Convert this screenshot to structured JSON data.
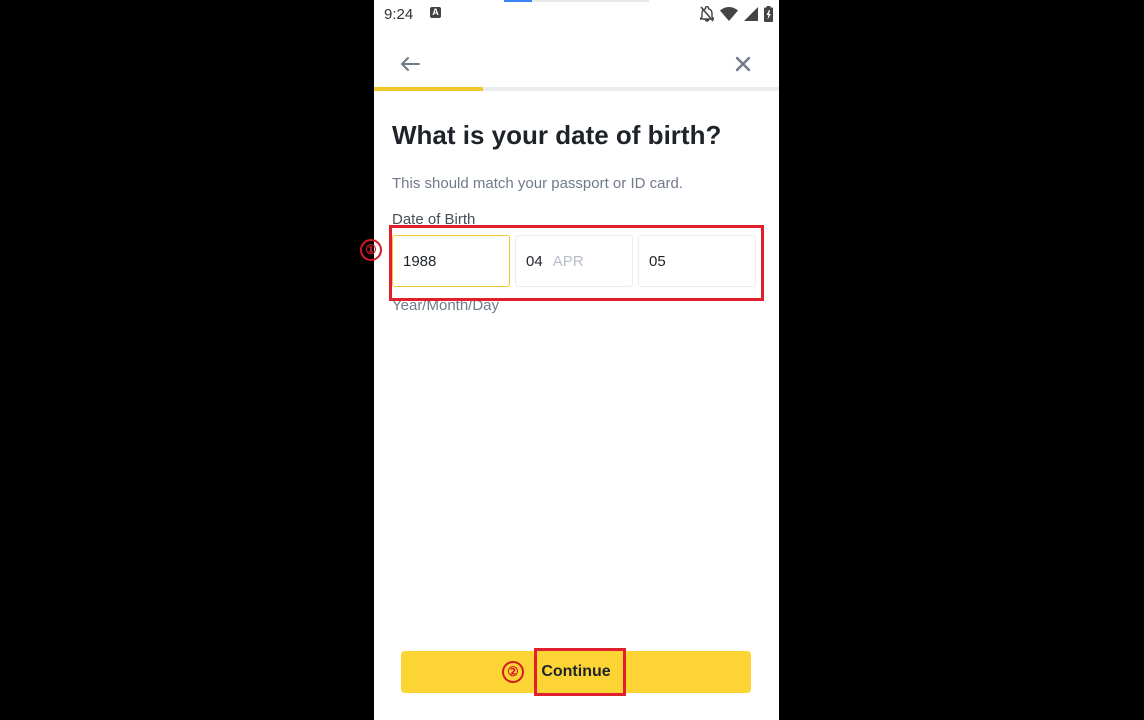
{
  "status_bar": {
    "time": "9:24",
    "app_icon_letter": "A",
    "icons": [
      "notifications-off-icon",
      "wifi-icon",
      "signal-icon",
      "battery-icon"
    ]
  },
  "header": {
    "back_icon": "arrow-left-icon",
    "close_icon": "close-icon"
  },
  "progress": {
    "fraction": 0.27,
    "color": "#f0c929"
  },
  "page": {
    "title": "What is your date of birth?",
    "subtitle": "This should match your passport or ID card.",
    "field_label": "Date of Birth",
    "helper": "Year/Month/Day"
  },
  "dob": {
    "year": "1988",
    "month": "04",
    "month_abbr": "APR",
    "day": "05"
  },
  "annotations": {
    "step1": "①",
    "step2": "②",
    "color": "#e0202c"
  },
  "actions": {
    "continue_label": "Continue",
    "button_color": "#fcd535"
  }
}
